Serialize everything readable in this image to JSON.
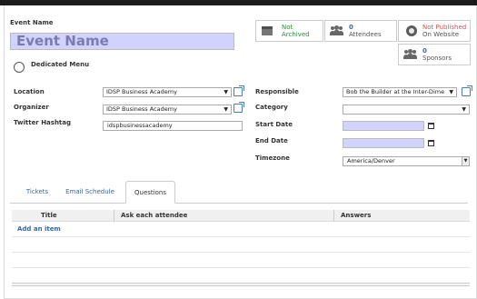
{
  "header": {
    "event_name_label": "Event Name",
    "event_name_value": "Event Name",
    "dedicated_menu_label": "Dedicated Menu"
  },
  "smart_buttons": {
    "archive": "Not Archived",
    "attendees_count": "0",
    "attendees_label": "Attendees",
    "publish_line1": "Not Published",
    "publish_line2": "On Website",
    "sponsors_count": "0",
    "sponsors_label": "Sponsors"
  },
  "left_fields": {
    "location_label": "Location",
    "location_value": "IDSP Business Academy",
    "organizer_label": "Organizer",
    "organizer_value": "IDSP Business Academy",
    "twitter_label": "Twitter Hashtag",
    "twitter_value": "idspbusinessacademy"
  },
  "right_fields": {
    "responsible_label": "Responsible",
    "responsible_value": "Bob the Builder at the Inter-Dime",
    "category_label": "Category",
    "category_value": "",
    "start_date_label": "Start Date",
    "end_date_label": "End Date",
    "timezone_label": "Timezone",
    "timezone_value": "America/Denver"
  },
  "tabs": [
    {
      "label": "Tickets"
    },
    {
      "label": "Email Schedule"
    },
    {
      "label": "Questions"
    }
  ],
  "questions_grid": {
    "columns": [
      "Title",
      "Ask each attendee",
      "Answers"
    ],
    "add_item": "Add an item"
  },
  "colors": {
    "required_bg": "#d2d2ff",
    "link": "#3a68a8",
    "archived_green": "#2e8b3e",
    "unpublished_red": "#d9534f"
  }
}
